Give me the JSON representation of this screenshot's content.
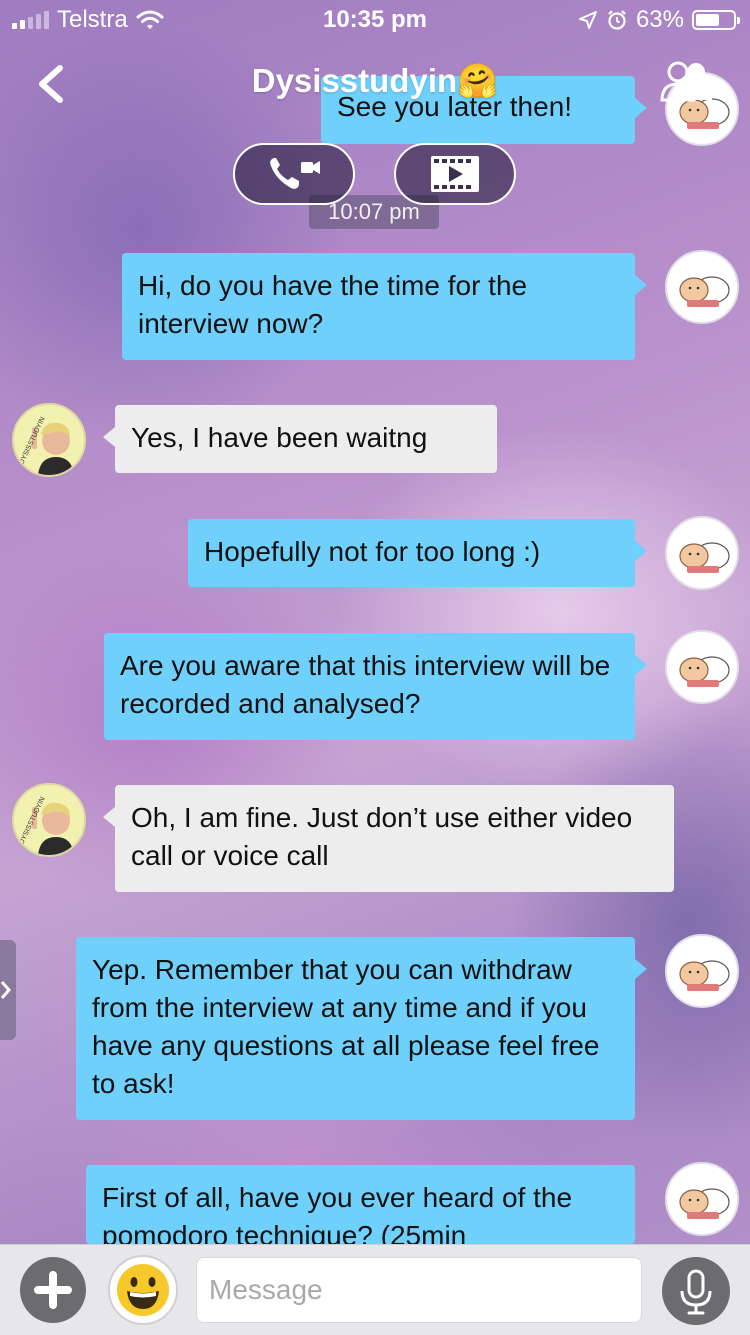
{
  "status_bar": {
    "carrier": "Telstra",
    "time": "10:35 pm",
    "battery": "63%",
    "battery_level": 0.63
  },
  "header": {
    "title": "Dysisstudyin🤗"
  },
  "calls": {
    "voice_icon": "phone-video-icon",
    "video_icon": "film-play-icon"
  },
  "timestamp": "10:07 pm",
  "messages": [
    {
      "side": "out",
      "text": "See you later then!"
    },
    {
      "side": "out",
      "text": "Hi, do you have the time for the interview now?"
    },
    {
      "side": "in",
      "text": "Yes, I have been waitng"
    },
    {
      "side": "out",
      "text": "Hopefully not for too long :)"
    },
    {
      "side": "out",
      "text": "Are you aware that this interview will be recorded and analysed?"
    },
    {
      "side": "in",
      "text": "Oh, I am fine. Just don’t use either video call or voice call"
    },
    {
      "side": "out",
      "text": "Yep. Remember that you can withdraw from the interview at any time and if you have any questions at all please feel free to ask!"
    },
    {
      "side": "out",
      "text": "First of all, have you ever heard of the pomodoro technique? (25min"
    }
  ],
  "avatars": {
    "them_text": "DYSISSTUDYIN"
  },
  "composer": {
    "placeholder": "Message",
    "value": ""
  },
  "colors": {
    "outgoing": "#6fd0fb",
    "incoming": "#ededee"
  }
}
